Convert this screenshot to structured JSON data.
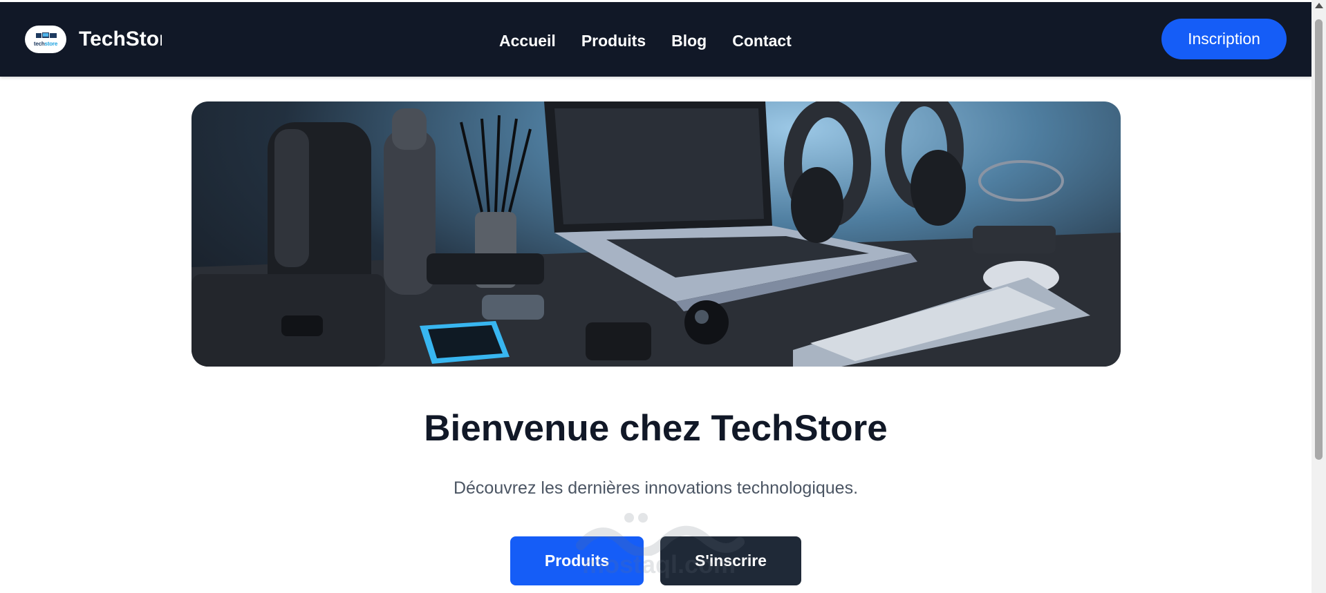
{
  "header": {
    "logo_text": "techstore",
    "brand_name": "TechStore",
    "nav": [
      {
        "label": "Accueil"
      },
      {
        "label": "Produits"
      },
      {
        "label": "Blog"
      },
      {
        "label": "Contact"
      }
    ],
    "signup_label": "Inscription"
  },
  "hero": {
    "image_icon": "tech-devices-photo"
  },
  "main": {
    "title": "Bienvenue chez TechStore",
    "subtitle": "Découvrez les dernières innovations technologiques.",
    "buttons": {
      "products_label": "Produits",
      "signup_label": "S'inscrire"
    }
  },
  "watermark": {
    "text": "mostaql.com"
  },
  "colors": {
    "navbar": "#111827",
    "primary": "#155df7",
    "secondary_button": "#1f2937",
    "title": "#111827",
    "subtitle": "#4b5563"
  }
}
